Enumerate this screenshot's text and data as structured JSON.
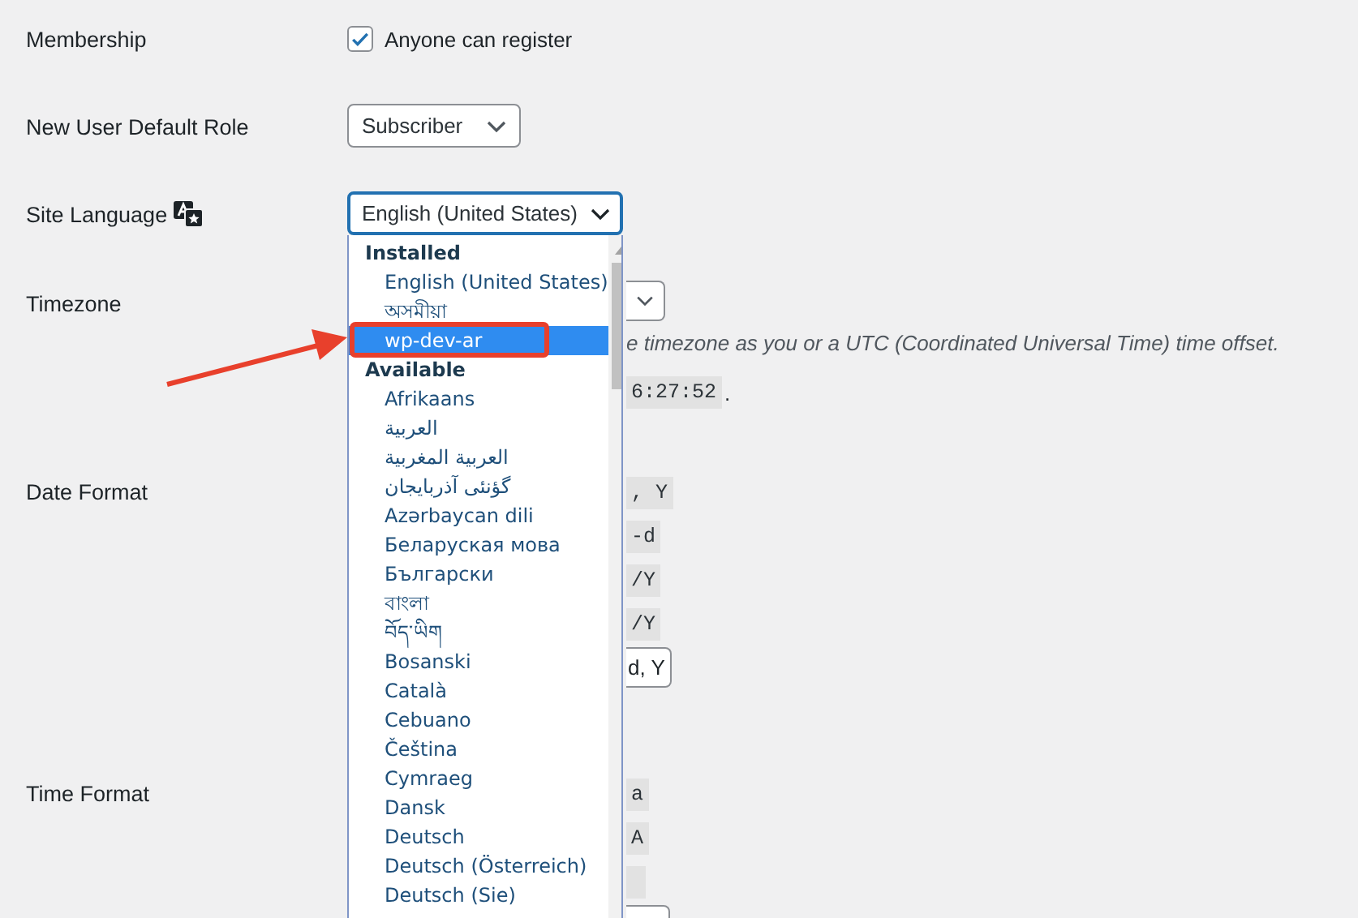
{
  "membership": {
    "label": "Membership",
    "option": {
      "label": "Anyone can register",
      "checked": true
    }
  },
  "default_role": {
    "label": "New User Default Role",
    "value": "Subscriber"
  },
  "site_language": {
    "label": "Site Language",
    "value": "English (United States)",
    "dropdown": {
      "groups": [
        {
          "label": "Installed",
          "options": [
            {
              "label": "English (United States)",
              "selected": false
            },
            {
              "label": "অসমীয়া",
              "selected": false
            },
            {
              "label": "wp-dev-ar",
              "selected": true
            }
          ]
        },
        {
          "label": "Available",
          "options": [
            {
              "label": "Afrikaans",
              "selected": false
            },
            {
              "label": "العربية",
              "selected": false
            },
            {
              "label": "العربية المغربية",
              "selected": false
            },
            {
              "label": "گؤنئی آذربایجان",
              "selected": false
            },
            {
              "label": "Azərbaycan dili",
              "selected": false
            },
            {
              "label": "Беларуская мова",
              "selected": false
            },
            {
              "label": "Български",
              "selected": false
            },
            {
              "label": "বাংলা",
              "selected": false
            },
            {
              "label": "བོད་ཡིག",
              "selected": false
            },
            {
              "label": "Bosanski",
              "selected": false
            },
            {
              "label": "Català",
              "selected": false
            },
            {
              "label": "Cebuano",
              "selected": false
            },
            {
              "label": "Čeština",
              "selected": false
            },
            {
              "label": "Cymraeg",
              "selected": false
            },
            {
              "label": "Dansk",
              "selected": false
            },
            {
              "label": "Deutsch",
              "selected": false
            },
            {
              "label": "Deutsch (Österreich)",
              "selected": false
            },
            {
              "label": "Deutsch (Sie)",
              "selected": false
            }
          ]
        }
      ]
    }
  },
  "timezone": {
    "label": "Timezone",
    "description": "e timezone as you or a UTC (Coordinated Universal Time) time offset.",
    "time": "6:27:52",
    "time_suffix": "."
  },
  "date_format": {
    "label": "Date Format",
    "fragments": [
      {
        "kind": "code",
        "text": ", Y"
      },
      {
        "kind": "code",
        "text": "-d"
      },
      {
        "kind": "code",
        "text": "/Y"
      },
      {
        "kind": "code",
        "text": "/Y"
      },
      {
        "kind": "field",
        "text": "d, Y"
      }
    ]
  },
  "time_format": {
    "label": "Time Format",
    "fragments": [
      {
        "kind": "code",
        "text": "a"
      },
      {
        "kind": "code",
        "text": "A"
      },
      {
        "kind": "blank"
      },
      {
        "kind": "field"
      }
    ]
  }
}
